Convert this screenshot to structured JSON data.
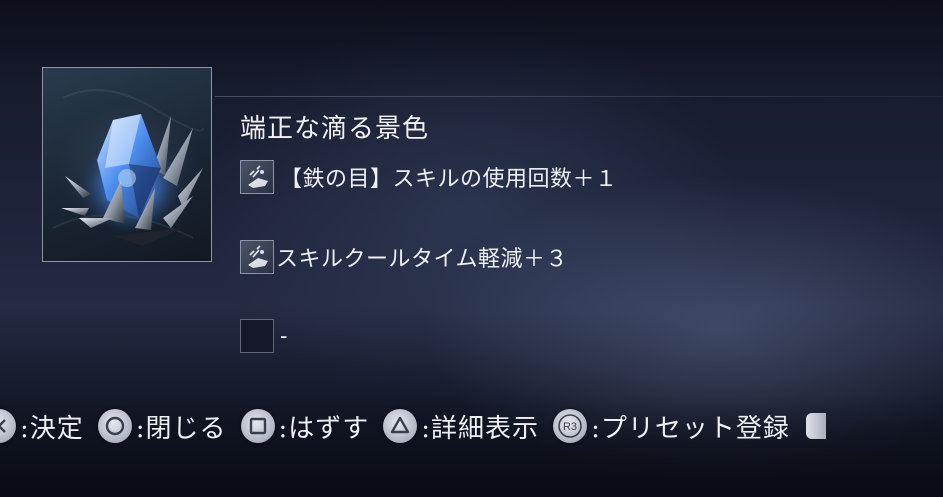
{
  "item": {
    "name": "端正な滴る景色",
    "icon": "blue-crystal-cluster-icon"
  },
  "effects": [
    {
      "icon": "skill-hand-icon",
      "text": "【鉄の目】スキルの使用回数＋１"
    },
    {
      "icon": "skill-hand-icon",
      "text": "スキルクールタイム軽減＋３"
    },
    {
      "icon": "empty-slot-icon",
      "text": "-"
    }
  ],
  "prompts": [
    {
      "button": "cross-button-icon",
      "label": ":決定"
    },
    {
      "button": "circle-button-icon",
      "label": ":閉じる"
    },
    {
      "button": "square-button-icon",
      "label": ":はずす"
    },
    {
      "button": "triangle-button-icon",
      "label": ":詳細表示"
    },
    {
      "button": "r3-button-icon",
      "glyph": "R3",
      "label": ":プリセット登録"
    }
  ],
  "colors": {
    "text": "#eef0f5",
    "frame_border": "#8b96ad",
    "crystal_glow": "#6fa8ff"
  }
}
